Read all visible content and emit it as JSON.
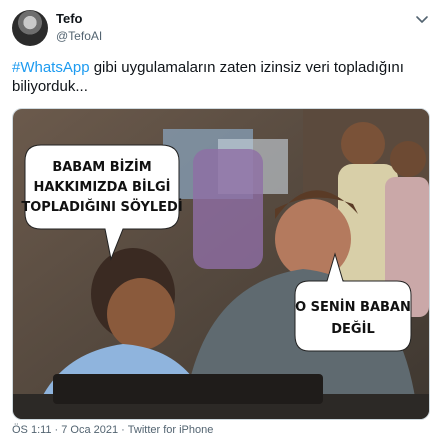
{
  "author": {
    "display_name": "Tefo",
    "handle": "@TefoAI"
  },
  "tweet": {
    "hashtag": "#WhatsApp",
    "text_rest": " gibi uygulamaların zaten izinsiz veri topladığını biliyorduk..."
  },
  "meme": {
    "left_bubble_lines": [
      "BABAM BİZİM",
      "HAKKIMIZDA BİLGİ",
      "TOPLADIĞINI SÖYLEDİ"
    ],
    "right_bubble_lines": [
      "O SENİN BABAN",
      "DEĞİL"
    ]
  },
  "meta": {
    "time": "ÖS 1:11",
    "date": "7 Oca 2021",
    "source": "Twitter for iPhone"
  },
  "colors": {
    "link": "#1d9bf0",
    "secondary_text": "#536471"
  }
}
